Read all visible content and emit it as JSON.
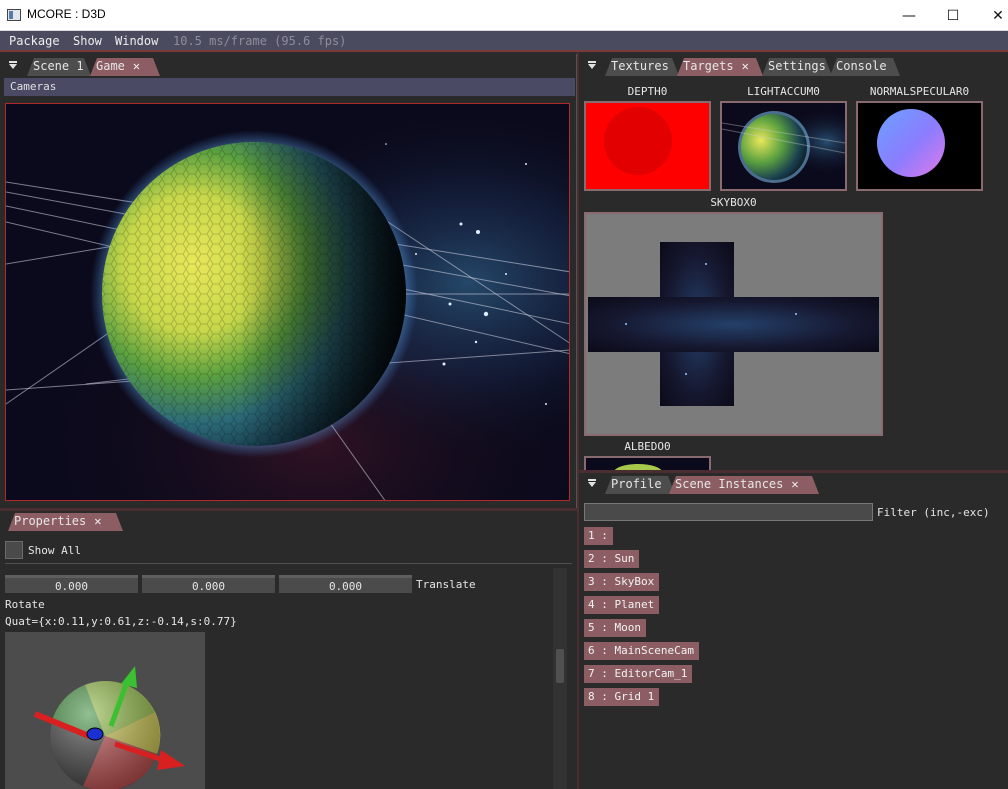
{
  "window": {
    "title": "MCORE : D3D",
    "controls": {
      "minimize": "—",
      "maximize": "☐",
      "close": "✕"
    }
  },
  "menu": {
    "items": [
      "Package",
      "Show",
      "Window"
    ],
    "fps_text": "10.5 ms/frame (95.6 fps)"
  },
  "scene_panel": {
    "tabs": [
      {
        "label": "Scene 1",
        "active": false,
        "closable": false
      },
      {
        "label": "Game",
        "active": true,
        "closable": true
      }
    ],
    "cameras_label": "Cameras"
  },
  "properties_panel": {
    "tab": {
      "label": "Properties",
      "closable": true
    },
    "show_all_label": "Show All",
    "translate": {
      "x": "0.000",
      "y": "0.000",
      "z": "0.000",
      "label": "Translate"
    },
    "rotate_label": "Rotate",
    "quat_text": "Quat={x:0.11,y:0.61,z:-0.14,s:0.77}"
  },
  "targets_panel": {
    "tabs": [
      {
        "label": "Textures",
        "active": false,
        "closable": false
      },
      {
        "label": "Targets",
        "active": true,
        "closable": true
      },
      {
        "label": "Settings",
        "active": false,
        "closable": false
      },
      {
        "label": "Console",
        "active": false,
        "closable": false
      }
    ],
    "targets": {
      "depth": "DEPTH0",
      "lightaccum": "LIGHTACCUM0",
      "normalspecular": "NORMALSPECULAR0",
      "skybox": "SKYBOX0",
      "albedo": "ALBEDO0"
    }
  },
  "instances_panel": {
    "tabs": [
      {
        "label": "Profile",
        "active": false,
        "closable": false
      },
      {
        "label": "Scene Instances",
        "active": true,
        "closable": true
      }
    ],
    "filter_label": "Filter (inc,-exc)",
    "filter_value": "",
    "instances": [
      "1 :",
      "2 : Sun",
      "3 : SkyBox",
      "4 : Planet",
      "5 : Moon",
      "6 : MainSceneCam",
      "7 : EditorCam_1",
      "8 : Grid 1"
    ]
  },
  "colors": {
    "accent_tab": "#8c5e63",
    "menubar": "#4b4b60",
    "viewport_border": "#b02a2a",
    "depth_target": "#ff0000"
  }
}
